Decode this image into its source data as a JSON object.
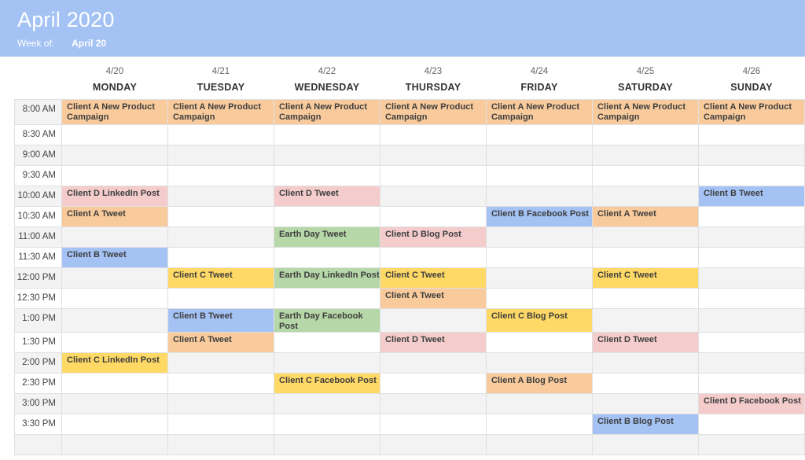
{
  "banner": {
    "title": "April 2020",
    "week_of_label": "Week of:",
    "week_of_value": "April 20",
    "background_color": "#a4c2f4",
    "text_color": "#ffffff"
  },
  "palette": {
    "orange": "#f9cb9c",
    "blue": "#a4c2f4",
    "yellow": "#ffd966",
    "pink": "#f4cccc",
    "green": "#b6d7a8",
    "row_shade": "#f3f3f3",
    "grid_line": "#e0e0e0"
  },
  "columns": [
    {
      "date": "4/20",
      "day": "MONDAY"
    },
    {
      "date": "4/21",
      "day": "TUESDAY"
    },
    {
      "date": "4/22",
      "day": "WEDNESDAY"
    },
    {
      "date": "4/23",
      "day": "THURSDAY"
    },
    {
      "date": "4/24",
      "day": "FRIDAY"
    },
    {
      "date": "4/25",
      "day": "SATURDAY"
    },
    {
      "date": "4/26",
      "day": "SUNDAY"
    }
  ],
  "time_slots": [
    "8:00 AM",
    "8:30 AM",
    "9:00 AM",
    "9:30 AM",
    "10:00 AM",
    "10:30 AM",
    "11:00 AM",
    "11:30 AM",
    "12:00 PM",
    "12:30 PM",
    "1:00 PM",
    "1:30 PM",
    "2:00 PM",
    "2:30 PM",
    "3:00 PM",
    "3:30 PM"
  ],
  "events": {
    "r0": [
      "Client A New Product Campaign",
      "Client A New Product Campaign",
      "Client A New Product Campaign",
      "Client A New Product Campaign",
      "Client A New Product Campaign",
      "Client A New Product Campaign",
      "Client A New Product Campaign"
    ],
    "r1": [
      "",
      "",
      "",
      "",
      "",
      "",
      ""
    ],
    "r2": [
      "",
      "",
      "",
      "",
      "",
      "",
      ""
    ],
    "r3": [
      "",
      "",
      "",
      "",
      "",
      "",
      ""
    ],
    "r4": [
      "Client D LinkedIn Post",
      "",
      "Client D Tweet",
      "",
      "",
      "",
      "Client B Tweet"
    ],
    "r5": [
      "Client A Tweet",
      "",
      "",
      "",
      "Client B Facebook Post",
      "Client A Tweet",
      ""
    ],
    "r6": [
      "",
      "",
      "Earth Day Tweet",
      "Client D Blog Post",
      "",
      "",
      ""
    ],
    "r7": [
      "Client B Tweet",
      "",
      "",
      "",
      "",
      "",
      ""
    ],
    "r8": [
      "",
      "Client C Tweet",
      "Earth Day LinkedIn Post",
      "Client C Tweet",
      "",
      "Client C Tweet",
      ""
    ],
    "r9": [
      "",
      "",
      "",
      "Client A Tweet",
      "",
      "",
      ""
    ],
    "r10": [
      "",
      "Client B Tweet",
      "Earth Day Facebook Post",
      "",
      "Client C Blog Post",
      "",
      ""
    ],
    "r11": [
      "",
      "Client A Tweet",
      "",
      "Client D Tweet",
      "",
      "Client D Tweet",
      ""
    ],
    "r12": [
      "Client C LinkedIn Post",
      "",
      "",
      "",
      "",
      "",
      ""
    ],
    "r13": [
      "",
      "",
      "Client C Facebook Post",
      "",
      "Client A Blog Post",
      "",
      ""
    ],
    "r14": [
      "",
      "",
      "",
      "",
      "",
      "",
      "Client D Facebook Post"
    ],
    "r15": [
      "",
      "",
      "",
      "",
      "",
      "Client B Blog Post",
      ""
    ]
  },
  "event_colors": {
    "r0": [
      "orange",
      "orange",
      "orange",
      "orange",
      "orange",
      "orange",
      "orange"
    ],
    "r1": [
      "",
      "",
      "",
      "",
      "",
      "",
      ""
    ],
    "r2": [
      "",
      "",
      "",
      "",
      "",
      "",
      ""
    ],
    "r3": [
      "",
      "",
      "",
      "",
      "",
      "",
      ""
    ],
    "r4": [
      "pink",
      "",
      "pink",
      "",
      "",
      "",
      "blue"
    ],
    "r5": [
      "orange",
      "",
      "",
      "",
      "blue",
      "orange",
      ""
    ],
    "r6": [
      "",
      "",
      "green",
      "pink",
      "",
      "",
      ""
    ],
    "r7": [
      "blue",
      "",
      "",
      "",
      "",
      "",
      ""
    ],
    "r8": [
      "",
      "yellow",
      "green",
      "yellow",
      "",
      "yellow",
      ""
    ],
    "r9": [
      "",
      "",
      "",
      "orange",
      "",
      "",
      ""
    ],
    "r10": [
      "",
      "blue",
      "green",
      "",
      "yellow",
      "",
      ""
    ],
    "r11": [
      "",
      "orange",
      "",
      "pink",
      "",
      "pink",
      ""
    ],
    "r12": [
      "yellow",
      "",
      "",
      "",
      "",
      "",
      ""
    ],
    "r13": [
      "",
      "",
      "yellow",
      "",
      "orange",
      "",
      ""
    ],
    "r14": [
      "",
      "",
      "",
      "",
      "",
      "",
      "pink"
    ],
    "r15": [
      "",
      "",
      "",
      "",
      "",
      "blue",
      ""
    ]
  }
}
